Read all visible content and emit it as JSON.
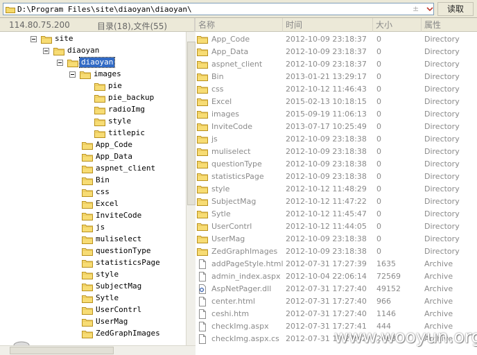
{
  "toolbar": {
    "path": "D:\\Program Files\\site\\diaoyan\\diaoyan\\",
    "decoration": "± ",
    "read_button": "读取"
  },
  "info": {
    "ip": "114.80.75.200",
    "counts": "目录(18),文件(55)"
  },
  "columns": {
    "name": "名称",
    "time": "时间",
    "size": "大小",
    "attr": "属性"
  },
  "tree": [
    {
      "label": "site",
      "level": 0,
      "expandable": true,
      "selected": false
    },
    {
      "label": "diaoyan",
      "level": 1,
      "expandable": true,
      "selected": false
    },
    {
      "label": "diaoyan",
      "level": 2,
      "expandable": true,
      "selected": true
    },
    {
      "label": "images",
      "level": 3,
      "expandable": true,
      "selected": false
    },
    {
      "label": "pie",
      "level": 4,
      "expandable": false,
      "selected": false
    },
    {
      "label": "pie_backup",
      "level": 4,
      "expandable": false,
      "selected": false
    },
    {
      "label": "radioImg",
      "level": 4,
      "expandable": false,
      "selected": false
    },
    {
      "label": "style",
      "level": 4,
      "expandable": false,
      "selected": false
    },
    {
      "label": "titlepic",
      "level": 4,
      "expandable": false,
      "selected": false
    },
    {
      "label": "App_Code",
      "level": 3,
      "expandable": false,
      "selected": false
    },
    {
      "label": "App_Data",
      "level": 3,
      "expandable": false,
      "selected": false
    },
    {
      "label": "aspnet_client",
      "level": 3,
      "expandable": false,
      "selected": false
    },
    {
      "label": "Bin",
      "level": 3,
      "expandable": false,
      "selected": false
    },
    {
      "label": "css",
      "level": 3,
      "expandable": false,
      "selected": false
    },
    {
      "label": "Excel",
      "level": 3,
      "expandable": false,
      "selected": false
    },
    {
      "label": "InviteCode",
      "level": 3,
      "expandable": false,
      "selected": false
    },
    {
      "label": "js",
      "level": 3,
      "expandable": false,
      "selected": false
    },
    {
      "label": "muliselect",
      "level": 3,
      "expandable": false,
      "selected": false
    },
    {
      "label": "questionType",
      "level": 3,
      "expandable": false,
      "selected": false
    },
    {
      "label": "statisticsPage",
      "level": 3,
      "expandable": false,
      "selected": false
    },
    {
      "label": "style",
      "level": 3,
      "expandable": false,
      "selected": false
    },
    {
      "label": "SubjectMag",
      "level": 3,
      "expandable": false,
      "selected": false
    },
    {
      "label": "Sytle",
      "level": 3,
      "expandable": false,
      "selected": false
    },
    {
      "label": "UserContrl",
      "level": 3,
      "expandable": false,
      "selected": false
    },
    {
      "label": "UserMag",
      "level": 3,
      "expandable": false,
      "selected": false
    },
    {
      "label": "ZedGraphImages",
      "level": 3,
      "expandable": false,
      "selected": false
    }
  ],
  "files": [
    {
      "name": "App_Code",
      "time": "2012-10-09 23:18:37",
      "size": "0",
      "attr": "Directory",
      "icon": "folder-icon"
    },
    {
      "name": "App_Data",
      "time": "2012-10-09 23:18:37",
      "size": "0",
      "attr": "Directory",
      "icon": "folder-icon"
    },
    {
      "name": "aspnet_client",
      "time": "2012-10-09 23:18:37",
      "size": "0",
      "attr": "Directory",
      "icon": "folder-icon"
    },
    {
      "name": "Bin",
      "time": "2013-01-21 13:29:17",
      "size": "0",
      "attr": "Directory",
      "icon": "folder-icon"
    },
    {
      "name": "css",
      "time": "2012-10-12 11:46:43",
      "size": "0",
      "attr": "Directory",
      "icon": "folder-icon"
    },
    {
      "name": "Excel",
      "time": "2015-02-13 10:18:15",
      "size": "0",
      "attr": "Directory",
      "icon": "folder-icon"
    },
    {
      "name": "images",
      "time": "2015-09-19 11:06:13",
      "size": "0",
      "attr": "Directory",
      "icon": "folder-icon"
    },
    {
      "name": "InviteCode",
      "time": "2013-07-17 10:25:49",
      "size": "0",
      "attr": "Directory",
      "icon": "folder-icon"
    },
    {
      "name": "js",
      "time": "2012-10-09 23:18:38",
      "size": "0",
      "attr": "Directory",
      "icon": "folder-icon"
    },
    {
      "name": "muliselect",
      "time": "2012-10-09 23:18:38",
      "size": "0",
      "attr": "Directory",
      "icon": "folder-icon"
    },
    {
      "name": "questionType",
      "time": "2012-10-09 23:18:38",
      "size": "0",
      "attr": "Directory",
      "icon": "folder-icon"
    },
    {
      "name": "statisticsPage",
      "time": "2012-10-09 23:18:38",
      "size": "0",
      "attr": "Directory",
      "icon": "folder-icon"
    },
    {
      "name": "style",
      "time": "2012-10-12 11:48:29",
      "size": "0",
      "attr": "Directory",
      "icon": "folder-icon"
    },
    {
      "name": "SubjectMag",
      "time": "2012-10-12 11:47:22",
      "size": "0",
      "attr": "Directory",
      "icon": "folder-icon"
    },
    {
      "name": "Sytle",
      "time": "2012-10-12 11:45:47",
      "size": "0",
      "attr": "Directory",
      "icon": "folder-icon"
    },
    {
      "name": "UserContrl",
      "time": "2012-10-12 11:44:05",
      "size": "0",
      "attr": "Directory",
      "icon": "folder-icon"
    },
    {
      "name": "UserMag",
      "time": "2012-10-09 23:18:38",
      "size": "0",
      "attr": "Directory",
      "icon": "folder-icon"
    },
    {
      "name": "ZedGraphImages",
      "time": "2012-10-09 23:18:38",
      "size": "0",
      "attr": "Directory",
      "icon": "folder-icon"
    },
    {
      "name": "addPageStyle.html",
      "time": "2012-07-31 17:27:39",
      "size": "1635",
      "attr": "Archive",
      "icon": "file-icon"
    },
    {
      "name": "admin_index.aspx",
      "time": "2012-10-04 22:06:14",
      "size": "72569",
      "attr": "Archive",
      "icon": "file-icon"
    },
    {
      "name": "AspNetPager.dll",
      "time": "2012-07-31 17:27:40",
      "size": "49152",
      "attr": "Archive",
      "icon": "dll-file-icon"
    },
    {
      "name": "center.html",
      "time": "2012-07-31 17:27:40",
      "size": "966",
      "attr": "Archive",
      "icon": "file-icon"
    },
    {
      "name": "ceshi.htm",
      "time": "2012-07-31 17:27:40",
      "size": "1146",
      "attr": "Archive",
      "icon": "file-icon"
    },
    {
      "name": "checkImg.aspx",
      "time": "2012-07-31 17:27:41",
      "size": "444",
      "attr": "Archive",
      "icon": "file-icon"
    },
    {
      "name": "checkImg.aspx.cs",
      "time": "2012-07-31 17:27:42",
      "size": "2668",
      "attr": "Archive",
      "icon": "file-icon"
    }
  ],
  "watermark": "www.wooyun.org"
}
